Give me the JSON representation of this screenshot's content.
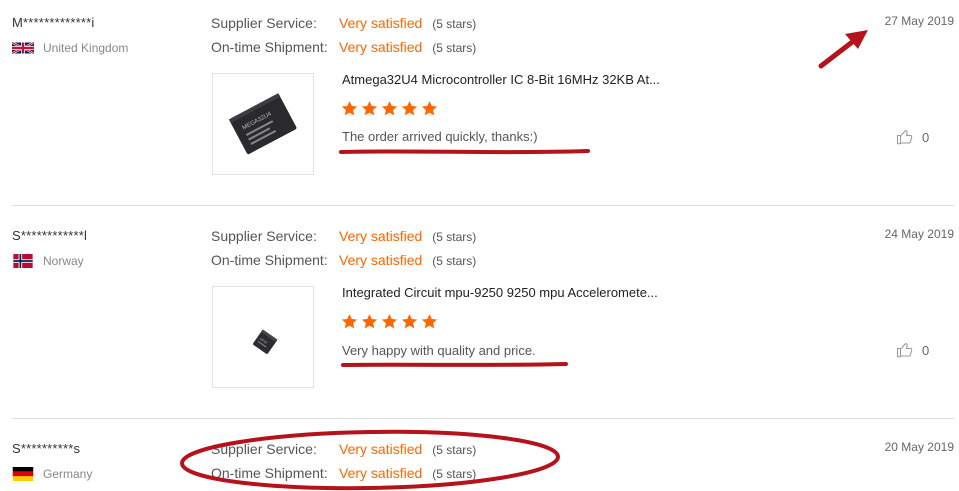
{
  "reviews": [
    {
      "buyer": "M*************i",
      "country": "United Kingdom",
      "flag": "uk-flag-icon",
      "supplier_label": "Supplier Service:",
      "supplier_value": "Very satisfied",
      "supplier_stars": "(5 stars)",
      "shipment_label": "On-time Shipment:",
      "shipment_value": "Very satisfied",
      "shipment_stars": "(5 stars)",
      "date": "27 May 2019",
      "product_title": "Atmega32U4 Microcontroller IC 8-Bit 16MHz 32KB At...",
      "rating": 5,
      "feedback": "The order arrived quickly, thanks:)",
      "helpful_count": "0",
      "chip_label": "MEGA32U4"
    },
    {
      "buyer": "S************l",
      "country": "Norway",
      "flag": "norway-flag-icon",
      "supplier_label": "Supplier Service:",
      "supplier_value": "Very satisfied",
      "supplier_stars": "(5 stars)",
      "shipment_label": "On-time Shipment:",
      "shipment_value": "Very satisfied",
      "shipment_stars": "(5 stars)",
      "date": "24 May 2019",
      "product_title": "Integrated Circuit mpu-9250 9250 mpu Acceleromete...",
      "rating": 5,
      "feedback": "Very happy with quality and price.",
      "helpful_count": "0",
      "chip_label": "MP92"
    },
    {
      "buyer": "S**********s",
      "country": "Germany",
      "flag": "germany-flag-icon",
      "supplier_label": "Supplier Service:",
      "supplier_value": "Very satisfied",
      "supplier_stars": "(5 stars)",
      "shipment_label": "On-time Shipment:",
      "shipment_value": "Very satisfied",
      "shipment_stars": "(5 stars)",
      "date": "20 May 2019"
    }
  ],
  "colors": {
    "accent": "#ff6600",
    "annotation": "#b5121b",
    "divider": "#dcdcdc"
  }
}
